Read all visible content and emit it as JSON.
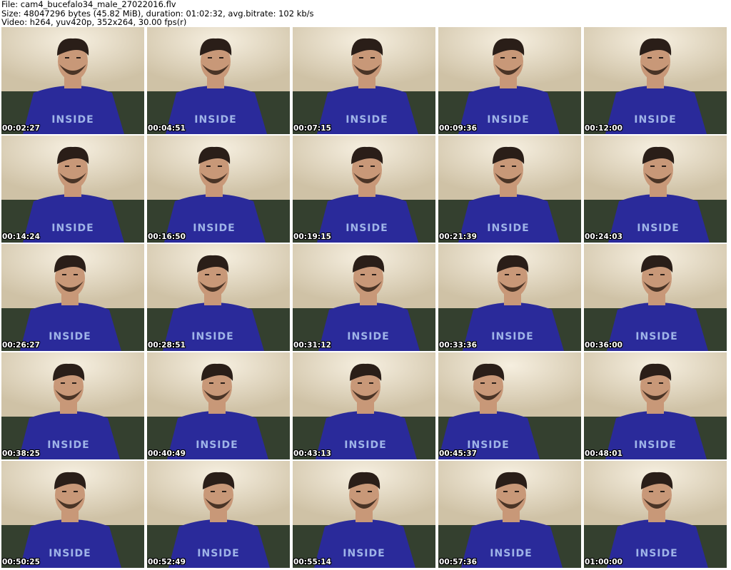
{
  "header": {
    "line1": "File: cam4_bucefalo34_male_27022016.flv",
    "line2": "Size: 48047296 bytes (45.82 MiB), duration: 01:02:32, avg.bitrate: 102 kb/s",
    "line3": "Video: h264, yuv420p, 352x264, 30.00 fps(r)"
  },
  "thumbnails": [
    {
      "timestamp": "00:02:27"
    },
    {
      "timestamp": "00:04:51"
    },
    {
      "timestamp": "00:07:15"
    },
    {
      "timestamp": "00:09:36"
    },
    {
      "timestamp": "00:12:00"
    },
    {
      "timestamp": "00:14:24"
    },
    {
      "timestamp": "00:16:50"
    },
    {
      "timestamp": "00:19:15"
    },
    {
      "timestamp": "00:21:39"
    },
    {
      "timestamp": "00:24:03"
    },
    {
      "timestamp": "00:26:27"
    },
    {
      "timestamp": "00:28:51"
    },
    {
      "timestamp": "00:31:12"
    },
    {
      "timestamp": "00:33:36"
    },
    {
      "timestamp": "00:36:00"
    },
    {
      "timestamp": "00:38:25"
    },
    {
      "timestamp": "00:40:49"
    },
    {
      "timestamp": "00:43:13"
    },
    {
      "timestamp": "00:45:37"
    },
    {
      "timestamp": "00:48:01"
    },
    {
      "timestamp": "00:50:25"
    },
    {
      "timestamp": "00:52:49"
    },
    {
      "timestamp": "00:55:14"
    },
    {
      "timestamp": "00:57:36"
    },
    {
      "timestamp": "01:00:00"
    }
  ],
  "shirt_text": "INSIDE",
  "colors": {
    "shirt": "#2a2a9a",
    "skin": "#c89878",
    "hair": "#2a1e18",
    "wall": "#e6dcc8",
    "sofa": "#34402f"
  }
}
